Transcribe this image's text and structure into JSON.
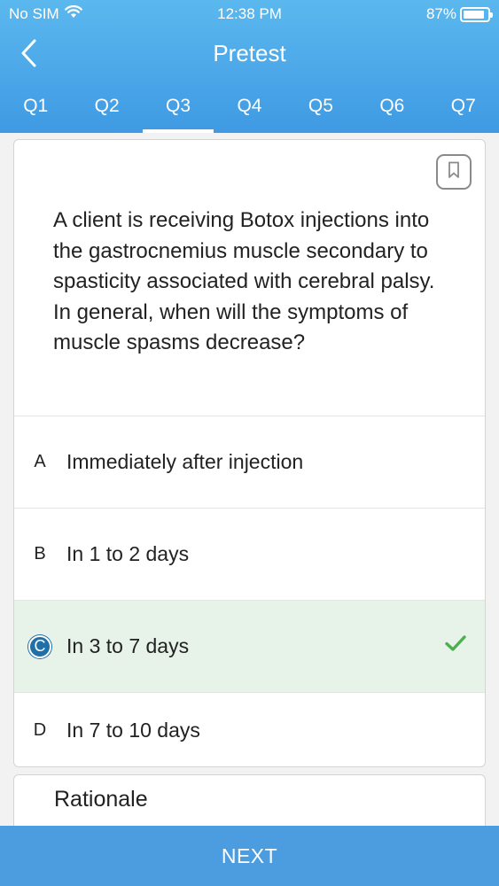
{
  "status_bar": {
    "carrier": "No SIM",
    "time": "12:38 PM",
    "battery_percent": "87%",
    "battery_level": 0.87
  },
  "nav": {
    "title": "Pretest",
    "back_icon": "chevron-left-icon"
  },
  "tabs": [
    {
      "label": "Q1"
    },
    {
      "label": "Q2"
    },
    {
      "label": "Q3",
      "active": true
    },
    {
      "label": "Q4"
    },
    {
      "label": "Q5"
    },
    {
      "label": "Q6"
    },
    {
      "label": "Q7"
    }
  ],
  "question": {
    "text": "A client is receiving Botox injections into the gastrocnemius muscle secondary to spasticity associated with cerebral palsy. In general, when will the symptoms of muscle spasms decrease?",
    "bookmark_icon": "bookmark-icon"
  },
  "options": [
    {
      "letter": "A",
      "text": "Immediately after injection"
    },
    {
      "letter": "B",
      "text": "In 1 to 2 days"
    },
    {
      "letter": "C",
      "text": "In 3 to 7 days",
      "selected": true,
      "correct": true
    },
    {
      "letter": "D",
      "text": "In 7 to 10 days"
    }
  ],
  "rationale": {
    "title": "Rationale"
  },
  "next_button": {
    "label": "NEXT"
  },
  "colors": {
    "header": "#4aa6e8",
    "correct_bg": "#e7f3e8",
    "check": "#4caf50",
    "selected_letter": "#1f6fa9"
  }
}
